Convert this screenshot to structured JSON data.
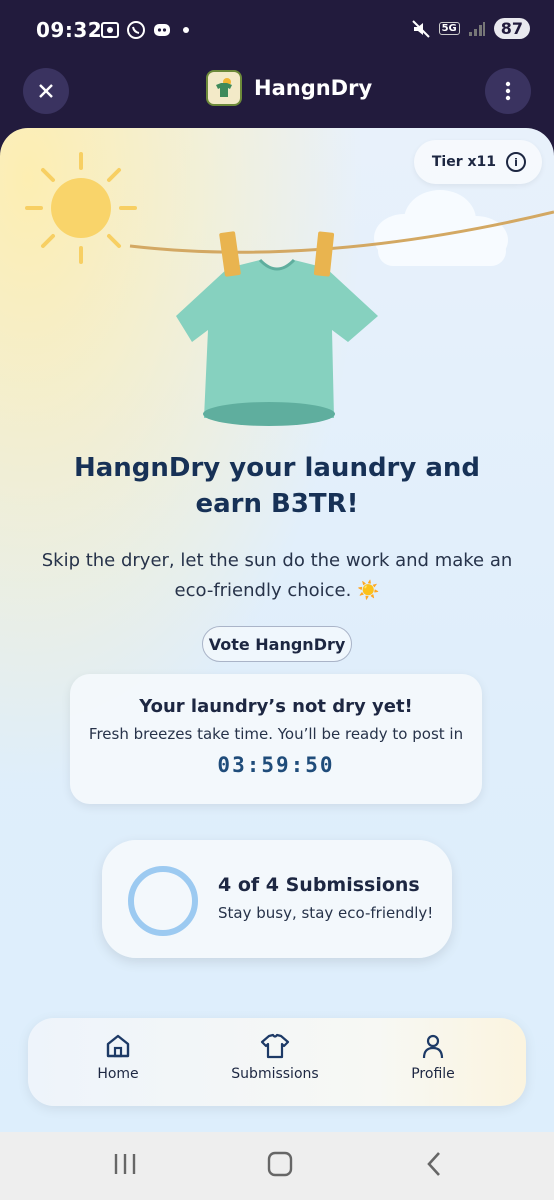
{
  "status_bar": {
    "time": "09:32",
    "network": "5G",
    "battery": "87"
  },
  "header": {
    "title": "HangnDry"
  },
  "tier": {
    "label": "Tier x11"
  },
  "hero": {
    "headline": "HangnDry your laundry and earn B3TR!",
    "subtext": "Skip the dryer, let the sun do the work and make an eco-friendly choice. ☀️",
    "vote_label": "Vote HangnDry"
  },
  "timer_card": {
    "title": "Your laundry’s not dry yet!",
    "subtitle": "Fresh breezes take time. You’ll be ready to post in",
    "countdown": "03:59:50"
  },
  "submissions_card": {
    "count_label": "4 of 4 Submissions",
    "tagline": "Stay busy, stay eco-friendly!"
  },
  "bottom_nav": {
    "items": [
      {
        "label": "Home",
        "icon": "home-icon"
      },
      {
        "label": "Submissions",
        "icon": "shirt-icon"
      },
      {
        "label": "Profile",
        "icon": "person-icon"
      }
    ]
  },
  "colors": {
    "header_bg": "#221b3d",
    "heading": "#173156",
    "ring": "#9ccaf1",
    "shirt": "#7fcbb8",
    "sun": "#f9d46a"
  }
}
